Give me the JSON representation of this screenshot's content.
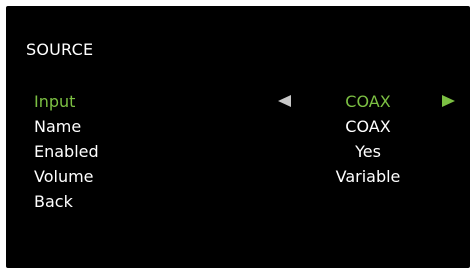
{
  "menu": {
    "title": "SOURCE",
    "selected_index": 0,
    "accent_color": "#7cc043",
    "items": [
      {
        "label": "Input",
        "value": "COAX",
        "arrows": [
          "left-arrow-icon",
          "right-arrow-icon"
        ]
      },
      {
        "label": "Name",
        "value": "COAX"
      },
      {
        "label": "Enabled",
        "value": "Yes"
      },
      {
        "label": "Volume",
        "value": "Variable"
      },
      {
        "label": "Back",
        "value": ""
      }
    ]
  }
}
